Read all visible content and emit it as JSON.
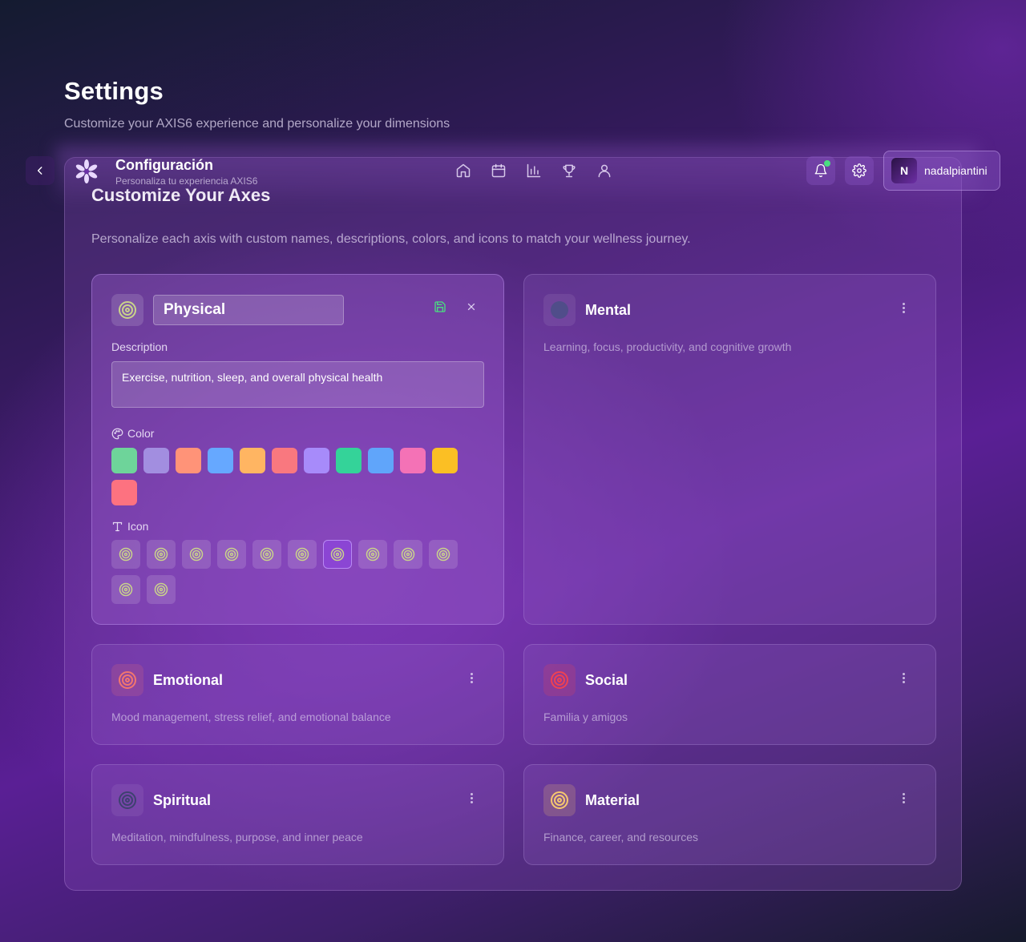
{
  "page": {
    "title": "Settings",
    "subtitle": "Customize your AXIS6 experience and personalize your dimensions"
  },
  "topbar": {
    "title": "Configuración",
    "subtitle": "Personaliza tu experiencia AXIS6",
    "nav_icons": [
      "home-icon",
      "calendar-icon",
      "bar-chart-icon",
      "trophy-icon",
      "user-icon"
    ],
    "notification_dot_color": "#4ade80",
    "user": {
      "initial": "N",
      "name": "nadalpiantini"
    }
  },
  "panel": {
    "title": "Customize Your Axes",
    "description": "Personalize each axis with custom names, descriptions, colors, and icons to match your wellness journey."
  },
  "editor": {
    "name_value": "Physical",
    "description_label": "Description",
    "description_value": "Exercise, nutrition, sleep, and overall physical health",
    "color_label": "Color",
    "icon_label": "Icon",
    "colors": [
      "#6ed49a",
      "#a28ee0",
      "#ff9378",
      "#66a8ff",
      "#ffb562",
      "#f9787f",
      "#a78bfa",
      "#34d399",
      "#60a5fa",
      "#f472b6",
      "#fbbf24",
      "#fd7280"
    ],
    "icon_count": 12,
    "selected_icon_index": 6,
    "icon_color": "#c9d38a"
  },
  "axes": [
    {
      "name": "Mental",
      "description": "Learning, focus, productivity, and cognitive growth",
      "icon_color": "#4a4f86"
    },
    {
      "name": "Emotional",
      "description": "Mood management, stress relief, and emotional balance",
      "icon_color": "#f2766e"
    },
    {
      "name": "Social",
      "description": "Familia y amigos",
      "icon_color": "#ef4152"
    },
    {
      "name": "Spiritual",
      "description": "Meditation, mindfulness, purpose, and inner peace",
      "icon_color": "#3e4170"
    },
    {
      "name": "Material",
      "description": "Finance, career, and resources",
      "icon_color": "#f7c86e"
    }
  ]
}
